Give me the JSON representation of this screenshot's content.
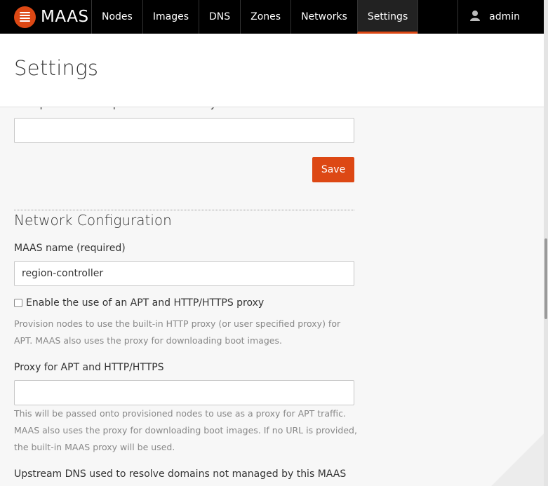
{
  "nav": {
    "logo_text": "MAAS",
    "items": [
      {
        "label": "Nodes"
      },
      {
        "label": "Images"
      },
      {
        "label": "DNS"
      },
      {
        "label": "Zones"
      },
      {
        "label": "Networks"
      },
      {
        "label": "Settings",
        "active": true
      }
    ],
    "user": "admin"
  },
  "header": {
    "title": "Settings"
  },
  "kernel": {
    "label": "Boot parameters to pass to the kernel by default",
    "value": "",
    "save_label": "Save"
  },
  "network": {
    "section_title": "Network Configuration",
    "maas_name_label": "MAAS name (required)",
    "maas_name_value": "region-controller",
    "proxy_checkbox_label": "Enable the use of an APT and HTTP/HTTPS proxy",
    "proxy_checkbox_checked": false,
    "proxy_checkbox_help_1": "Provision nodes to use the built-in HTTP proxy (or user specified proxy) for",
    "proxy_checkbox_help_2": "APT. MAAS also uses the proxy for downloading boot images.",
    "proxy_label": "Proxy for APT and HTTP/HTTPS",
    "proxy_value": "",
    "proxy_help_1": "This will be passed onto provisioned nodes to use as a proxy for APT traffic.",
    "proxy_help_2": "MAAS also uses the proxy for downloading boot images. If no URL is provided,",
    "proxy_help_3": "the built-in MAAS proxy will be used.",
    "upstream_dns_label": "Upstream DNS used to resolve domains not managed by this MAAS"
  },
  "colors": {
    "accent": "#dd4814",
    "nav_bg": "#000000",
    "page_bg": "#f7f7f7"
  }
}
